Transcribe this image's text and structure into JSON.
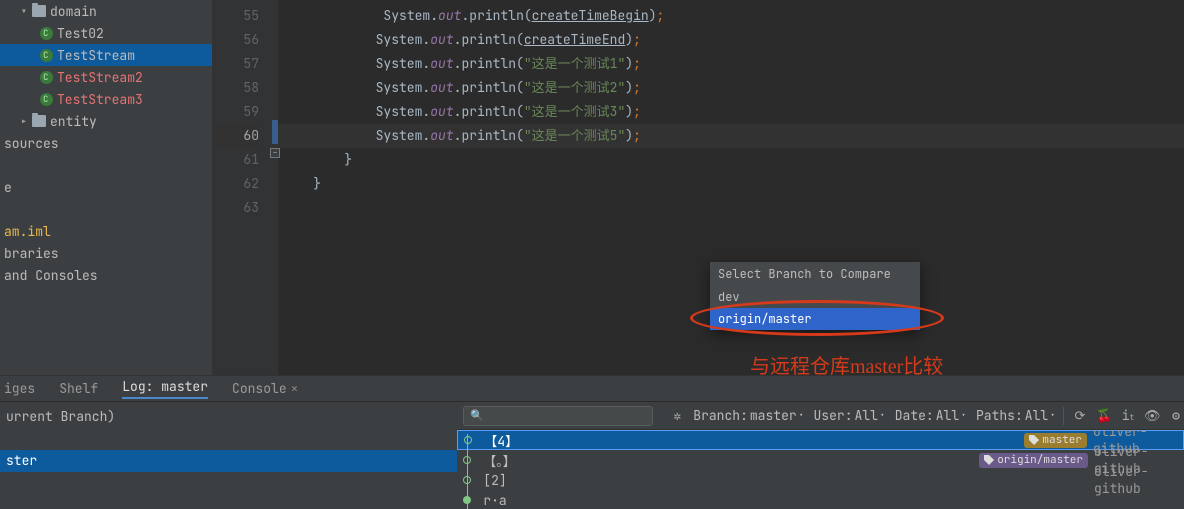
{
  "sidebar": {
    "items": [
      {
        "label": "domain",
        "kind": "folder",
        "indent": 1,
        "arrow": "▾"
      },
      {
        "label": "Test02",
        "kind": "class",
        "indent": 2,
        "cls": "file-nrm"
      },
      {
        "label": "TestStream",
        "kind": "class",
        "indent": 2,
        "cls": "file-nrm",
        "selected": true
      },
      {
        "label": "TestStream2",
        "kind": "class",
        "indent": 2,
        "cls": "file-red"
      },
      {
        "label": "TestStream3",
        "kind": "class",
        "indent": 2,
        "cls": "file-red"
      },
      {
        "label": "entity",
        "kind": "folder",
        "indent": 1,
        "arrow": "▸"
      },
      {
        "label": "sources",
        "kind": "text",
        "indent": 0
      },
      {
        "label": "",
        "kind": "spacer"
      },
      {
        "label": "e",
        "kind": "text",
        "indent": 0
      },
      {
        "label": "",
        "kind": "spacer"
      },
      {
        "label": "am.iml",
        "kind": "text",
        "indent": 0,
        "cls": "file-yel"
      },
      {
        "label": "braries",
        "kind": "text",
        "indent": 0
      },
      {
        "label": "and Consoles",
        "kind": "text",
        "indent": 0
      }
    ]
  },
  "code": {
    "lines": [
      {
        "n": 55,
        "parts": [
          {
            "t": " ",
            "c": ""
          },
          {
            "t": "            ",
            "c": ""
          },
          {
            "t": "System",
            "c": "sys"
          },
          {
            "t": ".",
            "c": "sys"
          },
          {
            "t": "out",
            "c": "fld"
          },
          {
            "t": ".",
            "c": "sys"
          },
          {
            "t": "println(",
            "c": "sys"
          },
          {
            "t": "createTimeBegin",
            "c": "id-u"
          },
          {
            "t": ")",
            "c": "sys"
          },
          {
            "t": ";",
            "c": "sc"
          }
        ]
      },
      {
        "n": 56,
        "parts": [
          {
            "t": "            ",
            "c": ""
          },
          {
            "t": "System",
            "c": "sys"
          },
          {
            "t": ".",
            "c": "sys"
          },
          {
            "t": "out",
            "c": "fld"
          },
          {
            "t": ".",
            "c": "sys"
          },
          {
            "t": "println(",
            "c": "sys"
          },
          {
            "t": "createTimeEnd",
            "c": "id-u"
          },
          {
            "t": ")",
            "c": "sys"
          },
          {
            "t": ";",
            "c": "sc"
          }
        ]
      },
      {
        "n": 57,
        "parts": [
          {
            "t": "            ",
            "c": ""
          },
          {
            "t": "System",
            "c": "sys"
          },
          {
            "t": ".",
            "c": "sys"
          },
          {
            "t": "out",
            "c": "fld"
          },
          {
            "t": ".",
            "c": "sys"
          },
          {
            "t": "println(",
            "c": "sys"
          },
          {
            "t": "\"这是一个测试1\"",
            "c": "str"
          },
          {
            "t": ")",
            "c": "sys"
          },
          {
            "t": ";",
            "c": "sc"
          }
        ]
      },
      {
        "n": 58,
        "parts": [
          {
            "t": "            ",
            "c": ""
          },
          {
            "t": "System",
            "c": "sys"
          },
          {
            "t": ".",
            "c": "sys"
          },
          {
            "t": "out",
            "c": "fld"
          },
          {
            "t": ".",
            "c": "sys"
          },
          {
            "t": "println(",
            "c": "sys"
          },
          {
            "t": "\"这是一个测试2\"",
            "c": "str"
          },
          {
            "t": ")",
            "c": "sys"
          },
          {
            "t": ";",
            "c": "sc"
          }
        ]
      },
      {
        "n": 59,
        "parts": [
          {
            "t": "            ",
            "c": ""
          },
          {
            "t": "System",
            "c": "sys"
          },
          {
            "t": ".",
            "c": "sys"
          },
          {
            "t": "out",
            "c": "fld"
          },
          {
            "t": ".",
            "c": "sys"
          },
          {
            "t": "println(",
            "c": "sys"
          },
          {
            "t": "\"这是一个测试3\"",
            "c": "str"
          },
          {
            "t": ")",
            "c": "sys"
          },
          {
            "t": ";",
            "c": "sc"
          }
        ]
      },
      {
        "n": 60,
        "hl": true,
        "parts": [
          {
            "t": "            ",
            "c": ""
          },
          {
            "t": "System",
            "c": "sys"
          },
          {
            "t": ".",
            "c": "sys"
          },
          {
            "t": "out",
            "c": "fld"
          },
          {
            "t": ".",
            "c": "sys"
          },
          {
            "t": "println(",
            "c": "sys"
          },
          {
            "t": "\"这是一个测试5\"",
            "c": "str"
          },
          {
            "t": ")",
            "c": "sys"
          },
          {
            "t": ";",
            "c": "sc"
          }
        ]
      },
      {
        "n": 61,
        "parts": [
          {
            "t": "        }",
            "c": "brc"
          }
        ]
      },
      {
        "n": 62,
        "parts": [
          {
            "t": "    }",
            "c": "brc"
          }
        ]
      },
      {
        "n": 63,
        "parts": [
          {
            "t": "",
            "c": ""
          }
        ]
      }
    ]
  },
  "popup": {
    "title": "Select Branch to Compare",
    "items": [
      {
        "label": "dev"
      },
      {
        "label": "origin/master",
        "selected": true
      }
    ]
  },
  "annotation": "与远程仓库master比较",
  "vcs": {
    "tabs": [
      {
        "label": "iges"
      },
      {
        "label": "Shelf"
      },
      {
        "label": "Log: master",
        "active": true
      },
      {
        "label": "Console",
        "close": true
      }
    ],
    "left": [
      {
        "label": "urrent Branch)"
      },
      {
        "label": ""
      },
      {
        "label": "ster",
        "selected": true
      }
    ],
    "toolbar": {
      "search_placeholder": "",
      "filters": [
        {
          "label": "Branch:",
          "value": "master"
        },
        {
          "label": "User:",
          "value": "All"
        },
        {
          "label": "Date:",
          "value": "All"
        },
        {
          "label": "Paths:",
          "value": "All"
        }
      ],
      "icons": [
        "refresh",
        "cherry",
        "it",
        "eye",
        "gear"
      ]
    },
    "log": [
      {
        "msg": "【4】",
        "dot": "open",
        "tags": [
          {
            "type": "yel",
            "label": "master"
          }
        ],
        "author": "oliver-github",
        "selected": true
      },
      {
        "msg": "【。】",
        "dot": "open",
        "tags": [
          {
            "type": "pur",
            "label": "origin/master"
          }
        ],
        "author": "oliver-github"
      },
      {
        "msg": "[2]",
        "dot": "open",
        "author": "oliver-github"
      },
      {
        "msg": "r·a",
        "dot": "fill",
        "author": ""
      }
    ]
  }
}
